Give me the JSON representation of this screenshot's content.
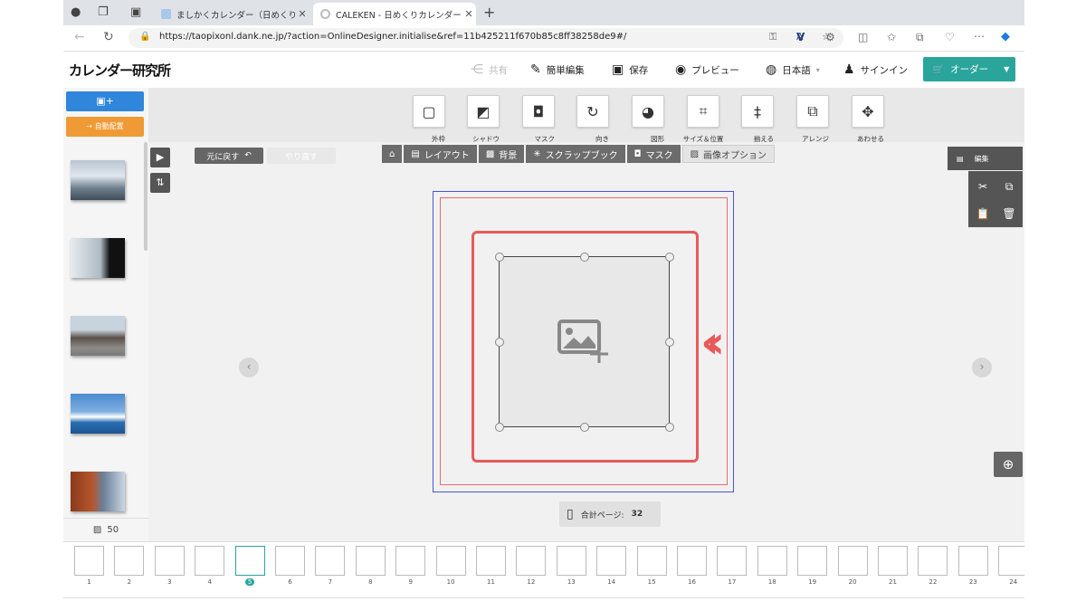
{
  "browser": {
    "tabs": [
      {
        "title": "ましかくカレンダー（日めくり）- Ca",
        "active": false
      },
      {
        "title": "CALEKEN - 日めくりカレンダーま",
        "active": true
      }
    ],
    "url": "https://taopixonl.dank.ne.jp/?action=OnlineDesigner.initialise&ref=11b425211f670b85c8ff38258de9#/"
  },
  "header": {
    "logo": "カレンダー研究所",
    "share": "共有",
    "simple_edit": "簡単編集",
    "save": "保存",
    "preview": "プレビュー",
    "language": "日本語",
    "signin": "サインイン",
    "order": "オーダー"
  },
  "left_panel": {
    "add_photos_label": "+",
    "auto_layout": "自動配置",
    "photo_count": "50",
    "photos": [
      "glacier",
      "snow-mountain",
      "welcome-sign",
      "cruise-ship",
      "cabin"
    ]
  },
  "toolbar": {
    "tools": [
      {
        "label": "外枠",
        "icon": "border-icon"
      },
      {
        "label": "シャドウ",
        "icon": "shadow-icon"
      },
      {
        "label": "マスク",
        "icon": "mask-icon"
      },
      {
        "label": "向き",
        "icon": "rotate-icon"
      },
      {
        "label": "図形",
        "icon": "shape-icon"
      },
      {
        "label": "サイズ＆位置",
        "icon": "size-position-icon"
      },
      {
        "label": "揃える",
        "icon": "align-icon"
      },
      {
        "label": "アレンジ",
        "icon": "arrange-icon"
      },
      {
        "label": "あわせる",
        "icon": "fit-icon"
      }
    ],
    "undo": "元に戻す",
    "redo": "やり直す",
    "subtabs": [
      "レイアウト",
      "背景",
      "スクラップブック",
      "マスク",
      "画像オプション"
    ],
    "edit": "編集"
  },
  "canvas": {
    "total_pages_label": "合計ページ:",
    "total_pages": "32"
  },
  "page_strip": {
    "pages": [
      "1",
      "2",
      "3",
      "4",
      "5",
      "6",
      "7",
      "8",
      "9",
      "10",
      "11",
      "12",
      "13",
      "14",
      "15",
      "16",
      "17",
      "18",
      "19",
      "20",
      "21",
      "22",
      "23",
      "24"
    ],
    "selected": "5"
  },
  "colors": {
    "order": "#2aa59c",
    "blue_btn": "#2f86da",
    "orange_btn": "#f09a35",
    "highlight": "#e85a5a"
  }
}
